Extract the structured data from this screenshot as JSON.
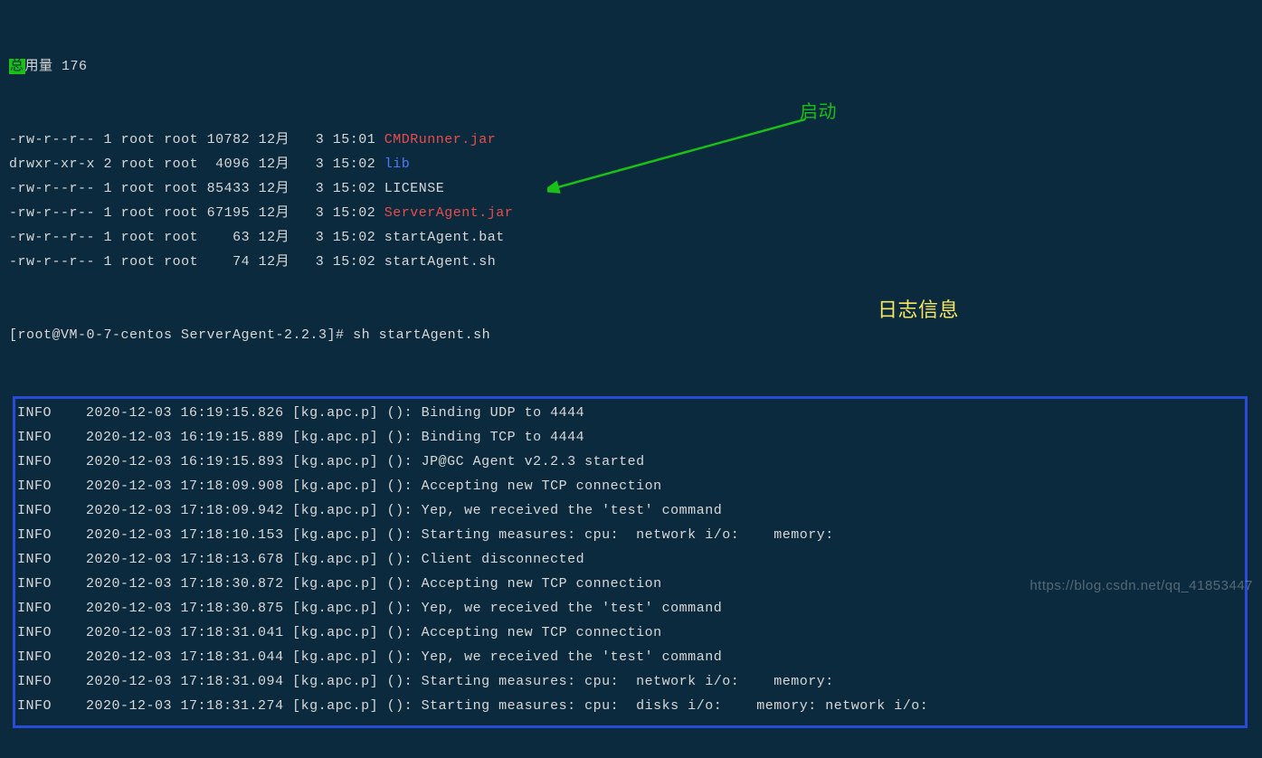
{
  "total_label": "总用量",
  "total_value": "176",
  "files": [
    {
      "perm": "-rw-r--r--",
      "links": "1",
      "owner": "root",
      "group": "root",
      "size": "10782",
      "month": "12月",
      "day": "3",
      "time": "15:01",
      "name": "CMDRunner.jar",
      "cls": "red"
    },
    {
      "perm": "drwxr-xr-x",
      "links": "2",
      "owner": "root",
      "group": "root",
      "size": "4096",
      "month": "12月",
      "day": "3",
      "time": "15:02",
      "name": "lib",
      "cls": "blue"
    },
    {
      "perm": "-rw-r--r--",
      "links": "1",
      "owner": "root",
      "group": "root",
      "size": "85433",
      "month": "12月",
      "day": "3",
      "time": "15:02",
      "name": "LICENSE",
      "cls": ""
    },
    {
      "perm": "-rw-r--r--",
      "links": "1",
      "owner": "root",
      "group": "root",
      "size": "67195",
      "month": "12月",
      "day": "3",
      "time": "15:02",
      "name": "ServerAgent.jar",
      "cls": "red"
    },
    {
      "perm": "-rw-r--r--",
      "links": "1",
      "owner": "root",
      "group": "root",
      "size": "63",
      "month": "12月",
      "day": "3",
      "time": "15:02",
      "name": "startAgent.bat",
      "cls": ""
    },
    {
      "perm": "-rw-r--r--",
      "links": "1",
      "owner": "root",
      "group": "root",
      "size": "74",
      "month": "12月",
      "day": "3",
      "time": "15:02",
      "name": "startAgent.sh",
      "cls": ""
    }
  ],
  "prompt": "[root@VM-0-7-centos ServerAgent-2.2.3]# ",
  "command": "sh startAgent.sh",
  "logs": [
    {
      "level": "INFO",
      "ts": "2020-12-03 16:19:15.826",
      "src": "[kg.apc.p] ():",
      "msg": "Binding UDP to 4444"
    },
    {
      "level": "INFO",
      "ts": "2020-12-03 16:19:15.889",
      "src": "[kg.apc.p] ():",
      "msg": "Binding TCP to 4444"
    },
    {
      "level": "INFO",
      "ts": "2020-12-03 16:19:15.893",
      "src": "[kg.apc.p] ():",
      "msg": "JP@GC Agent v2.2.3 started"
    },
    {
      "level": "INFO",
      "ts": "2020-12-03 17:18:09.908",
      "src": "[kg.apc.p] ():",
      "msg": "Accepting new TCP connection"
    },
    {
      "level": "INFO",
      "ts": "2020-12-03 17:18:09.942",
      "src": "[kg.apc.p] ():",
      "msg": "Yep, we received the 'test' command"
    },
    {
      "level": "INFO",
      "ts": "2020-12-03 17:18:10.153",
      "src": "[kg.apc.p] ():",
      "msg": "Starting measures: cpu:  network i/o:    memory:"
    },
    {
      "level": "INFO",
      "ts": "2020-12-03 17:18:13.678",
      "src": "[kg.apc.p] ():",
      "msg": "Client disconnected"
    },
    {
      "level": "INFO",
      "ts": "2020-12-03 17:18:30.872",
      "src": "[kg.apc.p] ():",
      "msg": "Accepting new TCP connection"
    },
    {
      "level": "INFO",
      "ts": "2020-12-03 17:18:30.875",
      "src": "[kg.apc.p] ():",
      "msg": "Yep, we received the 'test' command"
    },
    {
      "level": "INFO",
      "ts": "2020-12-03 17:18:31.041",
      "src": "[kg.apc.p] ():",
      "msg": "Accepting new TCP connection"
    },
    {
      "level": "INFO",
      "ts": "2020-12-03 17:18:31.044",
      "src": "[kg.apc.p] ():",
      "msg": "Yep, we received the 'test' command"
    },
    {
      "level": "INFO",
      "ts": "2020-12-03 17:18:31.094",
      "src": "[kg.apc.p] ():",
      "msg": "Starting measures: cpu:  network i/o:    memory:"
    },
    {
      "level": "INFO",
      "ts": "2020-12-03 17:18:31.274",
      "src": "[kg.apc.p] ():",
      "msg": "Starting measures: cpu:  disks i/o:    memory: network i/o:"
    }
  ],
  "annotation_start": "启动",
  "annotation_log": "日志信息",
  "watermark": "https://blog.csdn.net/qq_41853447"
}
